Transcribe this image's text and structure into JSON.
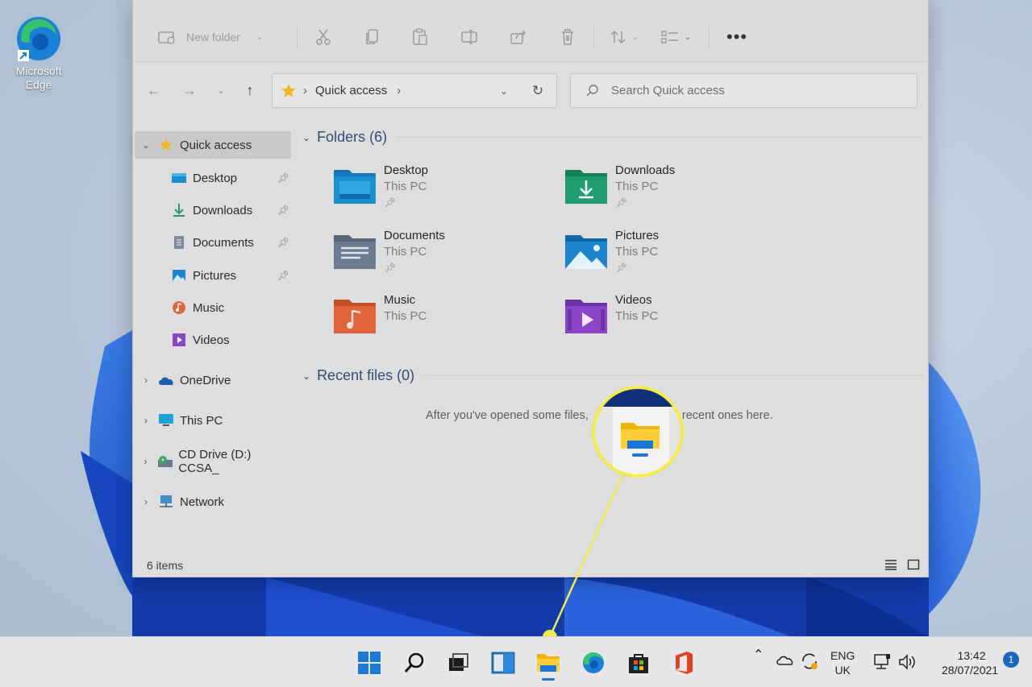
{
  "desktop": {
    "edge_icon_label": "Microsoft Edge"
  },
  "toolbar": {
    "new_folder_label": "New folder",
    "icons": [
      "cut-icon",
      "copy-icon",
      "paste-icon",
      "rename-icon",
      "share-icon",
      "delete-icon",
      "sort-icon",
      "view-icon",
      "more-icon"
    ]
  },
  "address_bar": {
    "location": "Quick access",
    "separator": "›"
  },
  "search": {
    "placeholder": "Search Quick access"
  },
  "sidebar": {
    "quick_access": "Quick access",
    "pinned": [
      {
        "label": "Desktop",
        "icon": "desktop-icon"
      },
      {
        "label": "Downloads",
        "icon": "downloads-icon"
      },
      {
        "label": "Documents",
        "icon": "documents-icon"
      },
      {
        "label": "Pictures",
        "icon": "pictures-icon"
      },
      {
        "label": "Music",
        "icon": "music-icon"
      },
      {
        "label": "Videos",
        "icon": "videos-icon"
      }
    ],
    "roots": [
      {
        "label": "OneDrive",
        "icon": "onedrive-icon"
      },
      {
        "label": "This PC",
        "icon": "this-pc-icon"
      },
      {
        "label": "CD Drive (D:) CCSA_",
        "icon": "cd-drive-icon"
      },
      {
        "label": "Network",
        "icon": "network-icon"
      }
    ]
  },
  "main": {
    "folders_header": "Folders (6)",
    "folders": [
      {
        "name": "Desktop",
        "location": "This PC",
        "color": "#1a8fd0"
      },
      {
        "name": "Downloads",
        "location": "This PC",
        "color": "#1e9e6e"
      },
      {
        "name": "Documents",
        "location": "This PC",
        "color": "#6a7c90"
      },
      {
        "name": "Pictures",
        "location": "This PC",
        "color": "#1a84cf"
      },
      {
        "name": "Music",
        "location": "This PC",
        "color": "#e0643a"
      },
      {
        "name": "Videos",
        "location": "This PC",
        "color": "#8b45c8"
      }
    ],
    "recent_header": "Recent files (0)",
    "recent_empty_message": "After you've opened some files,                    most recent ones here."
  },
  "status_bar": {
    "item_count": "6 items"
  },
  "taskbar": {
    "apps": [
      "start-icon",
      "search-icon",
      "task-view-icon",
      "widgets-icon",
      "file-explorer-icon",
      "edge-icon",
      "store-icon",
      "office-icon"
    ],
    "language": "ENG",
    "region": "UK",
    "time": "13:42",
    "date": "28/07/2021",
    "notifications": "1"
  },
  "colors": {
    "accent": "#0078d4",
    "callout": "#f3ec48"
  }
}
